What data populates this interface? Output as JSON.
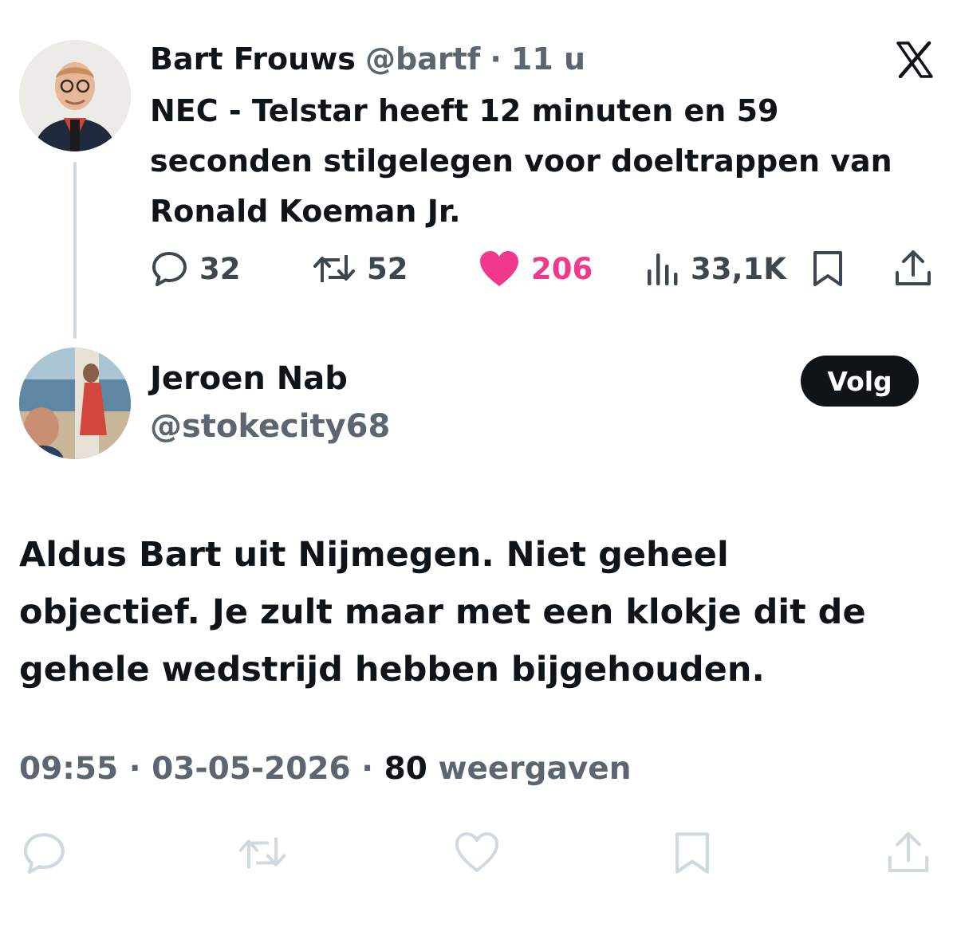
{
  "parent_tweet": {
    "author_name": "Bart Frouws",
    "handle": "@bartf",
    "separator": "·",
    "time_ago": "11 u",
    "text_lines": [
      "NEC - Telstar heeft 12 minuten en 59",
      "seconden stilgelegen voor doeltrappen van",
      "Ronald Koeman Jr."
    ],
    "actions": {
      "replies": "32",
      "reposts": "52",
      "likes": "206",
      "views": "33,1K"
    },
    "liked": true
  },
  "reply_tweet": {
    "author_name": "Jeroen Nab",
    "handle": "@stokecity68",
    "follow_label": "Volg",
    "text_lines": [
      "Aldus Bart uit Nijmegen. Niet geheel",
      "objectief. Je zult maar met een klokje dit de",
      "gehele wedstrijd hebben bijgehouden."
    ],
    "time": "09:55",
    "separator": "·",
    "date": "03-05-2026",
    "views_count": "80",
    "views_label": "weergaven"
  },
  "icons": {
    "close": "x-logo-icon",
    "reply": "speech-bubble-icon",
    "repost": "repost-arrows-icon",
    "like": "heart-icon",
    "views": "bar-chart-icon",
    "bookmark": "bookmark-icon",
    "share": "share-upload-icon"
  },
  "colors": {
    "like_active": "#f0398b",
    "text_primary": "#0f1419",
    "text_secondary": "#5b6670",
    "icon_muted": "#cfd9de",
    "follow_button_bg": "#0f1419"
  }
}
